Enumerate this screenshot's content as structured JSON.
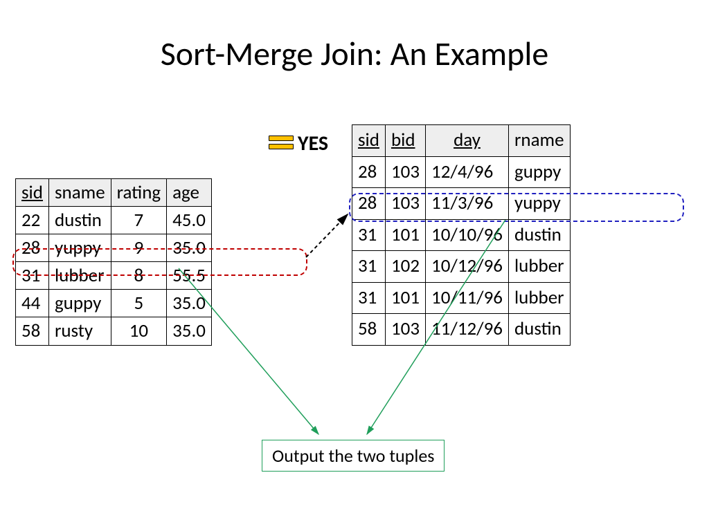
{
  "title": "Sort-Merge Join: An Example",
  "yes_label": "YES",
  "output_label": "Output the two tuples",
  "left_table": {
    "headers": [
      "sid",
      "sname",
      "rating",
      "age"
    ],
    "underlined": [
      true,
      false,
      false,
      false
    ],
    "rows": [
      [
        "22",
        "dustin",
        "7",
        "45.0"
      ],
      [
        "28",
        "yuppy",
        "9",
        "35.0"
      ],
      [
        "31",
        "lubber",
        "8",
        "55.5"
      ],
      [
        "44",
        "guppy",
        "5",
        "35.0"
      ],
      [
        "58",
        "rusty",
        "10",
        "35.0"
      ]
    ],
    "highlight_row": 1
  },
  "right_table": {
    "headers": [
      "sid",
      "bid",
      "day",
      "rname"
    ],
    "underlined": [
      true,
      true,
      true,
      false
    ],
    "rows": [
      [
        "28",
        "103",
        "12/4/96",
        "guppy"
      ],
      [
        "28",
        "103",
        "11/3/96",
        "yuppy"
      ],
      [
        "31",
        "101",
        "10/10/96",
        "dustin"
      ],
      [
        "31",
        "102",
        "10/12/96",
        "lubber"
      ],
      [
        "31",
        "101",
        "10/11/96",
        "lubber"
      ],
      [
        "58",
        "103",
        "11/12/96",
        "dustin"
      ]
    ],
    "highlight_row": 1
  }
}
